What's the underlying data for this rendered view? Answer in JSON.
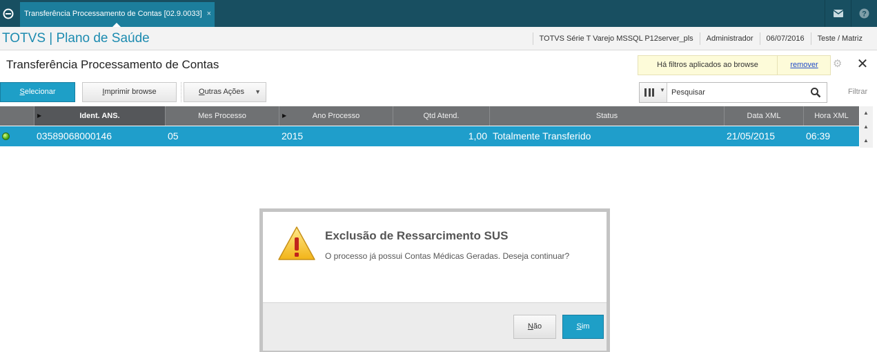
{
  "tab": {
    "title": "Transferência Processamento de Contas [02.9.0033]",
    "close": "×"
  },
  "header": {
    "app_title": "TOTVS | Plano de Saúde",
    "environment": "TOTVS Série T Varejo MSSQL P12server_pls",
    "user": "Administrador",
    "date": "06/07/2016",
    "branch": "Teste / Matriz"
  },
  "page": {
    "title": "Transferência Processamento de Contas",
    "filter_notice": "Há filtros aplicados ao browse",
    "filter_remove": "remover"
  },
  "toolbar": {
    "select_first": "S",
    "select_rest": "elecionar",
    "print_first": "I",
    "print_rest": "mprimir browse",
    "other_first": "O",
    "other_rest": "utras Ações",
    "search_placeholder": "Pesquisar",
    "filter": "Filtrar"
  },
  "grid": {
    "columns": [
      "Ident. ANS.",
      "Mes Processo",
      "Ano Processo",
      "Qtd Atend.",
      "Status",
      "Data XML",
      "Hora XML"
    ],
    "rows": [
      {
        "ident": "03589068000146",
        "mes": "05",
        "ano": "2015",
        "qtd": "1,00",
        "status": "Totalmente Transferido",
        "data_xml": "21/05/2015",
        "hora_xml": "06:39",
        "status_color": "#4cae18"
      }
    ]
  },
  "dialog": {
    "title": "Exclusão de Ressarcimento SUS",
    "message": "O processo já possui Contas Médicas Geradas. Deseja continuar?",
    "no_first": "N",
    "no_rest": "ão",
    "yes_first": "S",
    "yes_rest": "im"
  },
  "colors": {
    "accent": "#1e9fc7",
    "topbar": "#184f61",
    "tab": "#1c7e9c",
    "row_selected": "#1f9ecb"
  }
}
